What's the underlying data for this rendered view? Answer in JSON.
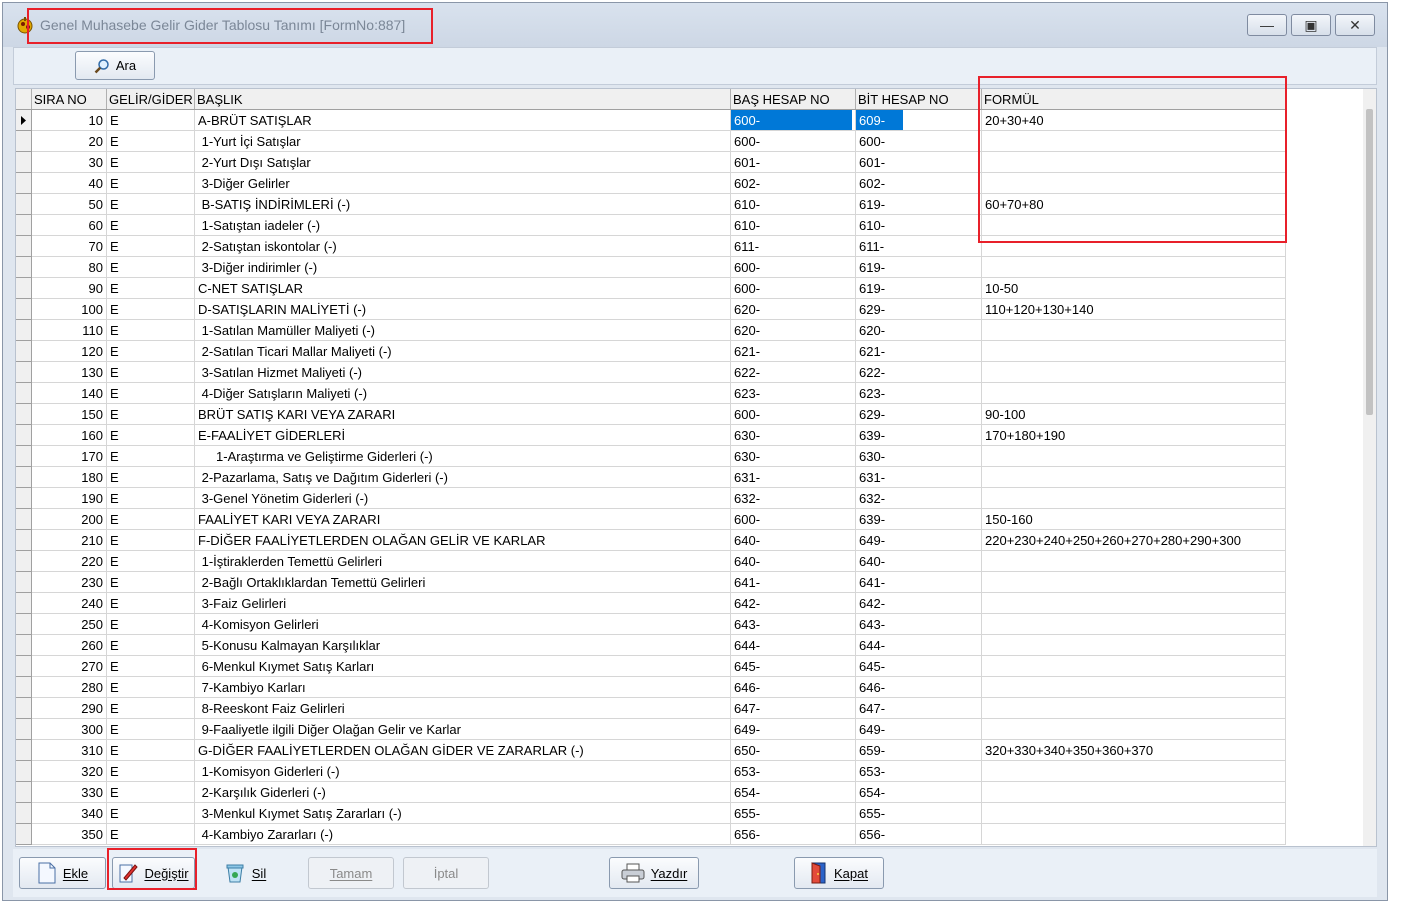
{
  "window": {
    "title": "Genel Muhasebe Gelir Gider Tablosu Tanımı [FormNo:887]"
  },
  "toolbar": {
    "search_label": "Ara"
  },
  "columns": [
    "SIRA NO",
    "GELİR/GİDER",
    "BAŞLIK",
    "BAŞ HESAP NO",
    "BİT HESAP NO",
    "FORMÜL"
  ],
  "rows": [
    {
      "sira": "10",
      "gg": "E",
      "baslik": "A-BRÜT SATIŞLAR",
      "bas": "600-",
      "bit": "609-",
      "formul": "20+30+40"
    },
    {
      "sira": "20",
      "gg": "E",
      "baslik": " 1-Yurt İçi Satışlar",
      "bas": "600-",
      "bit": "600-",
      "formul": ""
    },
    {
      "sira": "30",
      "gg": "E",
      "baslik": " 2-Yurt Dışı Satışlar",
      "bas": "601-",
      "bit": "601-",
      "formul": ""
    },
    {
      "sira": "40",
      "gg": "E",
      "baslik": " 3-Diğer Gelirler",
      "bas": "602-",
      "bit": "602-",
      "formul": ""
    },
    {
      "sira": "50",
      "gg": "E",
      "baslik": " B-SATIŞ İNDİRİMLERİ (-)",
      "bas": "610-",
      "bit": "619-",
      "formul": "60+70+80"
    },
    {
      "sira": "60",
      "gg": "E",
      "baslik": " 1-Satıştan iadeler (-)",
      "bas": "610-",
      "bit": "610-",
      "formul": ""
    },
    {
      "sira": "70",
      "gg": "E",
      "baslik": " 2-Satıştan iskontolar (-)",
      "bas": "611-",
      "bit": "611-",
      "formul": ""
    },
    {
      "sira": "80",
      "gg": "E",
      "baslik": " 3-Diğer indirimler (-)",
      "bas": "600-",
      "bit": "619-",
      "formul": ""
    },
    {
      "sira": "90",
      "gg": "E",
      "baslik": "C-NET SATIŞLAR",
      "bas": "600-",
      "bit": "619-",
      "formul": "10-50"
    },
    {
      "sira": "100",
      "gg": "E",
      "baslik": "D-SATIŞLARIN MALİYETİ (-)",
      "bas": "620-",
      "bit": "629-",
      "formul": "110+120+130+140"
    },
    {
      "sira": "110",
      "gg": "E",
      "baslik": " 1-Satılan Mamüller Maliyeti (-)",
      "bas": "620-",
      "bit": "620-",
      "formul": ""
    },
    {
      "sira": "120",
      "gg": "E",
      "baslik": " 2-Satılan Ticari Mallar Maliyeti (-)",
      "bas": "621-",
      "bit": "621-",
      "formul": ""
    },
    {
      "sira": "130",
      "gg": "E",
      "baslik": " 3-Satılan Hizmet Maliyeti (-)",
      "bas": "622-",
      "bit": "622-",
      "formul": ""
    },
    {
      "sira": "140",
      "gg": "E",
      "baslik": " 4-Diğer Satışların Maliyeti (-)",
      "bas": "623-",
      "bit": "623-",
      "formul": ""
    },
    {
      "sira": "150",
      "gg": "E",
      "baslik": "BRÜT SATIŞ KARI VEYA ZARARI",
      "bas": "600-",
      "bit": "629-",
      "formul": "90-100"
    },
    {
      "sira": "160",
      "gg": "E",
      "baslik": "E-FAALİYET GİDERLERİ",
      "bas": "630-",
      "bit": "639-",
      "formul": "170+180+190"
    },
    {
      "sira": "170",
      "gg": "E",
      "baslik": "     1-Araştırma ve Geliştirme Giderleri (-)",
      "bas": "630-",
      "bit": "630-",
      "formul": ""
    },
    {
      "sira": "180",
      "gg": "E",
      "baslik": " 2-Pazarlama, Satış ve Dağıtım Giderleri (-)",
      "bas": "631-",
      "bit": "631-",
      "formul": ""
    },
    {
      "sira": "190",
      "gg": "E",
      "baslik": " 3-Genel Yönetim Giderleri (-)",
      "bas": "632-",
      "bit": "632-",
      "formul": ""
    },
    {
      "sira": "200",
      "gg": "E",
      "baslik": "FAALİYET KARI VEYA ZARARI",
      "bas": "600-",
      "bit": "639-",
      "formul": "150-160"
    },
    {
      "sira": "210",
      "gg": "E",
      "baslik": "F-DİĞER FAALİYETLERDEN OLAĞAN GELİR VE KARLAR",
      "bas": "640-",
      "bit": "649-",
      "formul": "220+230+240+250+260+270+280+290+300"
    },
    {
      "sira": "220",
      "gg": "E",
      "baslik": " 1-İştiraklerden Temettü Gelirleri",
      "bas": "640-",
      "bit": "640-",
      "formul": ""
    },
    {
      "sira": "230",
      "gg": "E",
      "baslik": " 2-Bağlı Ortaklıklardan Temettü Gelirleri",
      "bas": "641-",
      "bit": "641-",
      "formul": ""
    },
    {
      "sira": "240",
      "gg": "E",
      "baslik": " 3-Faiz Gelirleri",
      "bas": "642-",
      "bit": "642-",
      "formul": ""
    },
    {
      "sira": "250",
      "gg": "E",
      "baslik": " 4-Komisyon Gelirleri",
      "bas": "643-",
      "bit": "643-",
      "formul": ""
    },
    {
      "sira": "260",
      "gg": "E",
      "baslik": " 5-Konusu Kalmayan Karşılıklar",
      "bas": "644-",
      "bit": "644-",
      "formul": ""
    },
    {
      "sira": "270",
      "gg": "E",
      "baslik": " 6-Menkul Kıymet Satış Karları",
      "bas": "645-",
      "bit": "645-",
      "formul": ""
    },
    {
      "sira": "280",
      "gg": "E",
      "baslik": " 7-Kambiyo Karları",
      "bas": "646-",
      "bit": "646-",
      "formul": ""
    },
    {
      "sira": "290",
      "gg": "E",
      "baslik": " 8-Reeskont Faiz Gelirleri",
      "bas": "647-",
      "bit": "647-",
      "formul": ""
    },
    {
      "sira": "300",
      "gg": "E",
      "baslik": " 9-Faaliyetle ilgili Diğer Olağan Gelir ve Karlar",
      "bas": "649-",
      "bit": "649-",
      "formul": ""
    },
    {
      "sira": "310",
      "gg": "E",
      "baslik": "G-DİĞER FAALİYETLERDEN OLAĞAN GİDER VE ZARARLAR (-)",
      "bas": "650-",
      "bit": "659-",
      "formul": "320+330+340+350+360+370"
    },
    {
      "sira": "320",
      "gg": "E",
      "baslik": " 1-Komisyon Giderleri (-)",
      "bas": "653-",
      "bit": "653-",
      "formul": ""
    },
    {
      "sira": "330",
      "gg": "E",
      "baslik": " 2-Karşılık Giderleri (-)",
      "bas": "654-",
      "bit": "654-",
      "formul": ""
    },
    {
      "sira": "340",
      "gg": "E",
      "baslik": " 3-Menkul Kıymet Satış Zararları (-)",
      "bas": "655-",
      "bit": "655-",
      "formul": ""
    },
    {
      "sira": "350",
      "gg": "E",
      "baslik": " 4-Kambiyo Zararları (-)",
      "bas": "656-",
      "bit": "656-",
      "formul": ""
    }
  ],
  "bottom": {
    "ekle": "Ekle",
    "degistir": "Değiştir",
    "sil": "Sil",
    "tamam": "Tamam",
    "iptal": "İptal",
    "yazdir": "Yazdır",
    "kapat": "Kapat"
  },
  "colors": {
    "selection": "#0078d7",
    "highlight_box": "#e8202a"
  }
}
